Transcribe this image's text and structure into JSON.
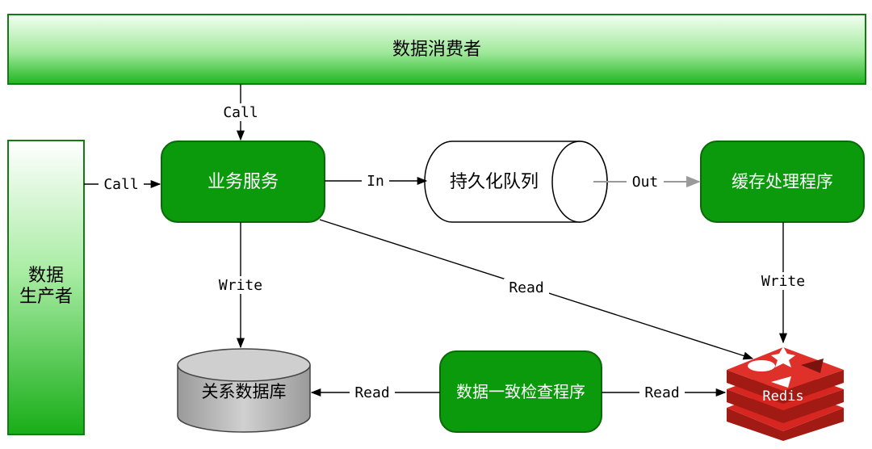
{
  "consumer": {
    "label": "数据消费者"
  },
  "producer": {
    "line1": "数据",
    "line2": "生产者"
  },
  "business_service": {
    "label": "业务服务"
  },
  "queue": {
    "label": "持久化队列"
  },
  "cache_processor": {
    "label": "缓存处理程序"
  },
  "database": {
    "label": "关系数据库"
  },
  "consistency_checker": {
    "label": "数据一致检查程序"
  },
  "redis": {
    "label": "Redis"
  },
  "edges": {
    "consumer_call": "Call",
    "producer_call": "Call",
    "queue_in": "In",
    "queue_out": "Out",
    "service_write": "Write",
    "cache_write": "Write",
    "service_read": "Read",
    "checker_read_db": "Read",
    "checker_read_redis": "Read"
  },
  "colors": {
    "node_green": "#0b9a0b",
    "bar_green_light": "#e9ffe6",
    "bar_green_dark": "#1fb51f",
    "db_gray": "#b9b9b9",
    "redis_red": "#d7261f"
  }
}
